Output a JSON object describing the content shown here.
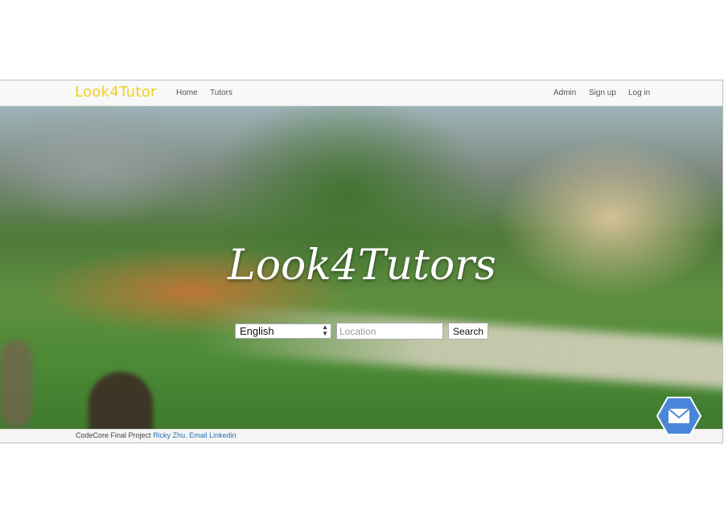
{
  "navbar": {
    "brand": "Look4Tutor",
    "left_links": [
      "Home",
      "Tutors"
    ],
    "right_links": [
      "Admin",
      "Sign up",
      "Log in"
    ]
  },
  "hero": {
    "title": "Look4Tutors",
    "search": {
      "language_selected": "English",
      "location_placeholder": "Location",
      "button_label": "Search"
    }
  },
  "footer": {
    "text": "CodeCore Final Project",
    "author_link": "Ricky Zhu.",
    "links": [
      "Email",
      "Linkedin"
    ]
  },
  "floating": {
    "icon": "mail-icon",
    "color": "#4a86d8"
  },
  "colors": {
    "brand": "#f2d21b",
    "link": "#2a6fb5"
  }
}
